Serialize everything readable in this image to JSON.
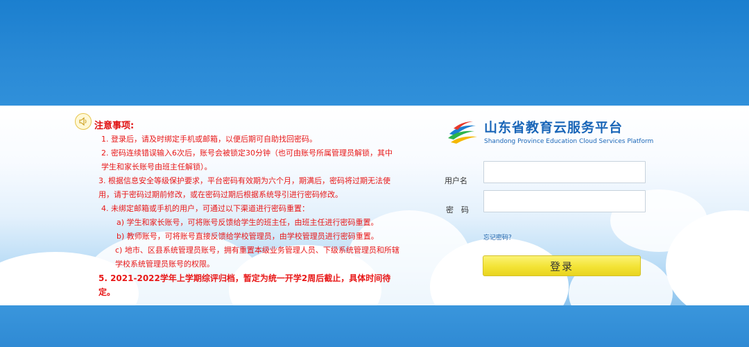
{
  "notice": {
    "icon": "speaker-icon",
    "title": "注意事项:",
    "items": [
      "1. 登录后，请及时绑定手机或邮箱，以便后期可自助找回密码。",
      "2. 密码连续错误输入6次后，账号会被锁定30分钟（也可由账号所属管理员解锁，其中学生和家长账号由班主任解锁）。",
      "3. 根据信息安全等级保护要求，平台密码有效期为六个月，期满后，密码将过期无法使用，请于密码过期前修改，或在密码过期后根据系统导引进行密码修改。",
      "4. 未绑定邮箱或手机的用户，可通过以下渠道进行密码重置：",
      "a) 学生和家长账号，可将账号反馈给学生的班主任，由班主任进行密码重置。",
      "b) 教师账号，可将账号直接反馈给学校管理员，由学校管理员进行密码重置。",
      "c) 地市、区县系统管理员账号，拥有重置本级业务管理人员、下级系统管理员和所辖学校系统管理员账号的权限。",
      "5. 2021-2022学年上学期综评归档，暂定为统一开学2周后截止，具体时间待定。"
    ]
  },
  "logo": {
    "icon": "platform-logo-icon",
    "title": "山东省教育云服务平台",
    "subtitle": "Shandong Province Education Cloud Services Platform",
    "colors": [
      "#e8392a",
      "#f5b800",
      "#2db34a",
      "#1d7fd0"
    ]
  },
  "login": {
    "username_label": "用户名",
    "username_value": "",
    "password_label": "密　码",
    "password_value": "",
    "forgot_label": "忘记密码？",
    "submit_label": "登录"
  },
  "colors": {
    "band": "#2f8fd6",
    "notice_text": "#e81818",
    "brand": "#1a66b8",
    "button": "#f3e335"
  }
}
